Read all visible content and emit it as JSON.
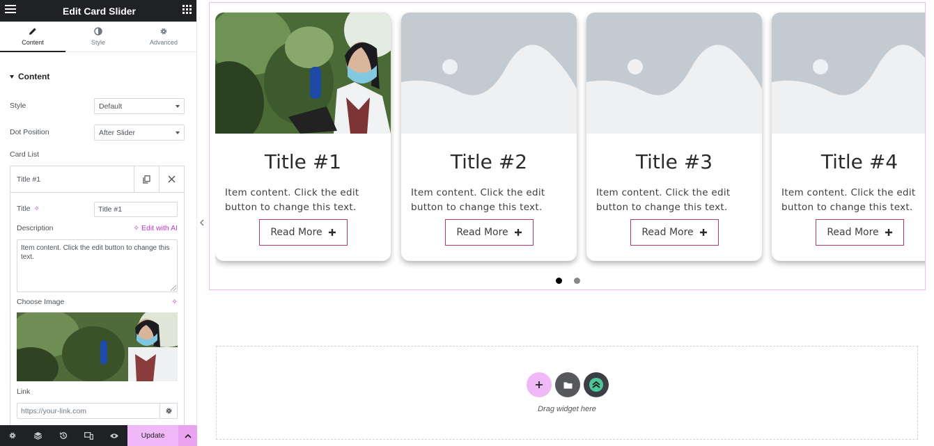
{
  "panel": {
    "title": "Edit Card Slider",
    "tabs": [
      {
        "label": "Content",
        "icon": "pencil-icon",
        "active": true
      },
      {
        "label": "Style",
        "icon": "contrast-icon",
        "active": false
      },
      {
        "label": "Advanced",
        "icon": "gear-icon",
        "active": false
      }
    ],
    "section_title": "Content",
    "style": {
      "label": "Style",
      "value": "Default"
    },
    "dot_position": {
      "label": "Dot Position",
      "value": "After Slider"
    },
    "card_list_label": "Card List",
    "item": {
      "header": "Title #1",
      "title_label": "Title",
      "title_value": "Title #1",
      "description_label": "Description",
      "edit_ai": "Edit with AI",
      "description_value": "Item content. Click the edit button to change this text.",
      "image_label": "Choose Image",
      "link_label": "Link",
      "link_placeholder": "https://your-link.com"
    },
    "footer": {
      "update_label": "Update"
    }
  },
  "slider": {
    "cards": [
      {
        "title": "Title #1",
        "description": "Item content. Click the edit button to change this text.",
        "button": "Read More",
        "has_photo": true
      },
      {
        "title": "Title #2",
        "description": "Item content. Click the edit button to change this text.",
        "button": "Read More",
        "has_photo": false
      },
      {
        "title": "Title #3",
        "description": "Item content. Click the edit button to change this text.",
        "button": "Read More",
        "has_photo": false
      },
      {
        "title": "Title #4",
        "description": "Item content. Click the edit button to change this text.",
        "button": "Read More",
        "has_photo": false
      }
    ],
    "dots": 2,
    "active_dot": 0
  },
  "drop_zone": {
    "text": "Drag widget here"
  },
  "colors": {
    "accent": "#f0b8f6",
    "button_border": "#b2395f",
    "panel_dark": "#1f2124",
    "ai": "#c036c7"
  }
}
